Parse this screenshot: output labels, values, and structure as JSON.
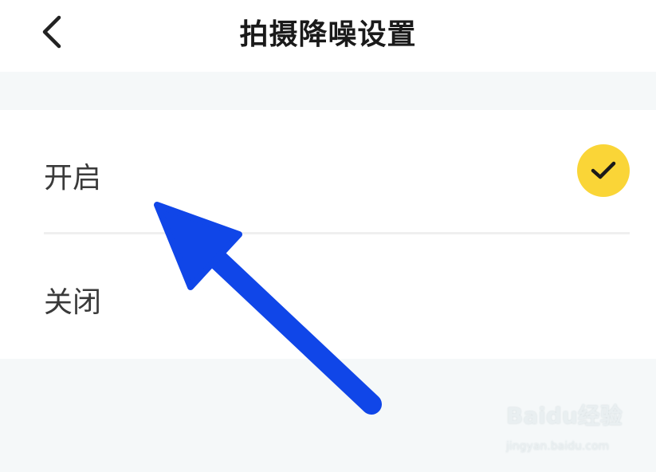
{
  "header": {
    "title": "拍摄降噪设置",
    "back_icon": "chevron-left-icon"
  },
  "options": [
    {
      "label": "开启",
      "selected": true
    },
    {
      "label": "关闭",
      "selected": false
    }
  ],
  "colors": {
    "check_bg": "#fad537",
    "check_mark": "#1a1a1a",
    "arrow": "#1046e8",
    "background": "#f5f8f9"
  },
  "annotation": {
    "arrow_icon": "pointer-arrow"
  },
  "watermark": {
    "brand": "Baidu经验",
    "sub": "jingyan.baidu.com"
  }
}
